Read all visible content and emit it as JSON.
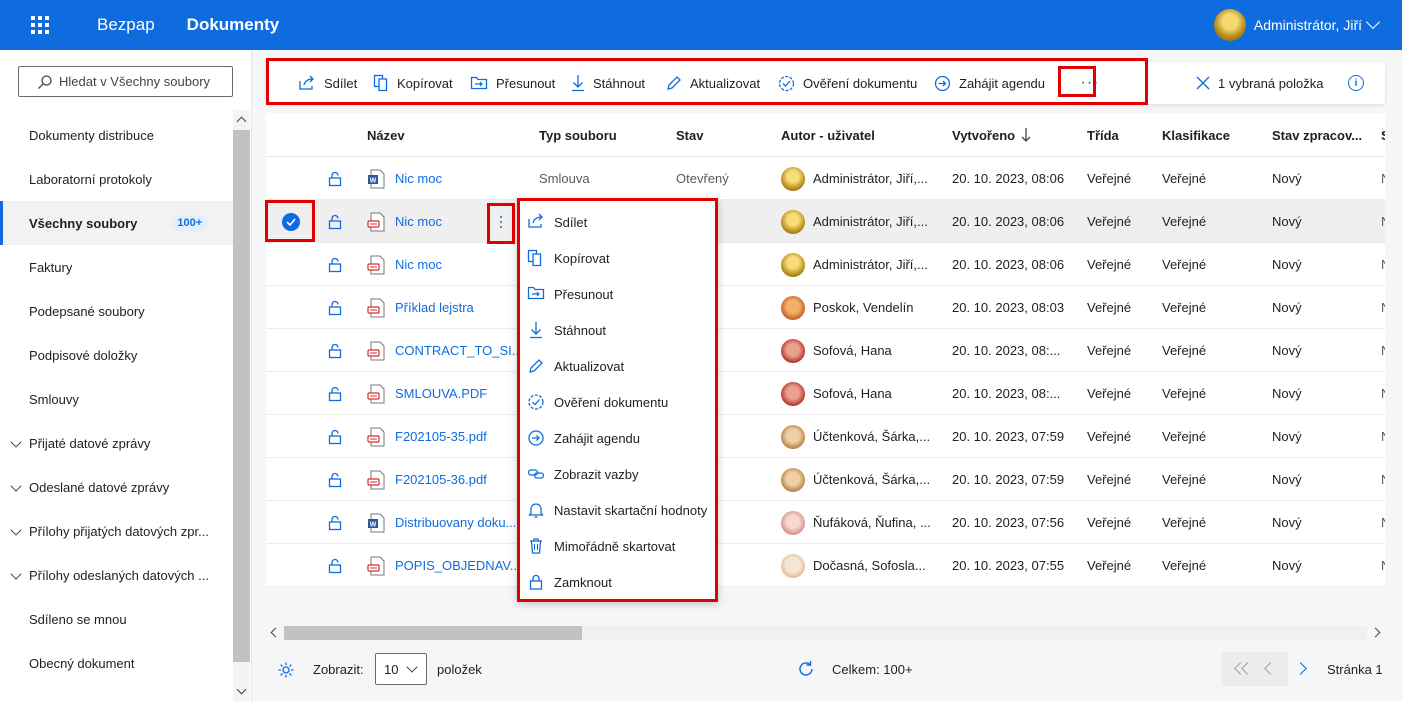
{
  "topbar": {
    "app_name": "Bezpap",
    "section": "Dokumenty",
    "user_name": "Administrátor, Jiří"
  },
  "sidebar": {
    "search_placeholder": "Hledat v Všechny soubory",
    "items": [
      {
        "label": "Dokumenty distribuce",
        "expandable": false
      },
      {
        "label": "Laboratorní protokoly",
        "expandable": false
      },
      {
        "label": "Všechny soubory",
        "expandable": false,
        "active": true,
        "badge": "100+"
      },
      {
        "label": "Faktury",
        "expandable": false
      },
      {
        "label": "Podepsané soubory",
        "expandable": false
      },
      {
        "label": "Podpisové doložky",
        "expandable": false
      },
      {
        "label": "Smlouvy",
        "expandable": false
      },
      {
        "label": "Přijaté datové zprávy",
        "expandable": true
      },
      {
        "label": "Odeslané datové zprávy",
        "expandable": true
      },
      {
        "label": "Přílohy přijatých datových zpr...",
        "expandable": true
      },
      {
        "label": "Přílohy odeslaných datových ...",
        "expandable": true
      },
      {
        "label": "Sdíleno se mnou",
        "expandable": false
      },
      {
        "label": "Obecný dokument",
        "expandable": false
      }
    ]
  },
  "commandbar": {
    "share": "Sdílet",
    "copy": "Kopírovat",
    "move": "Přesunout",
    "download": "Stáhnout",
    "update": "Aktualizovat",
    "verify": "Ověření dokumentu",
    "start_agenda": "Zahájit agendu",
    "more": "···",
    "selection": "1 vybraná položka",
    "info": "i"
  },
  "table": {
    "headers": {
      "name": "Název",
      "type": "Typ souboru",
      "state": "Stav",
      "author": "Autor - uživatel",
      "created": "Vytvořeno",
      "class": "Třída",
      "classification": "Klasifikace",
      "processing": "Stav zpracov...",
      "extra": "S"
    },
    "rows": [
      {
        "icon": "word",
        "name": "Nic moc",
        "type": "Smlouva",
        "state": "Otevřený",
        "author": "Administrátor, Jiří,...",
        "avatar": "gold",
        "created": "20. 10. 2023, 08:06",
        "class": "Veřejné",
        "classification": "Veřejné",
        "processing": "Nový",
        "extra": "N"
      },
      {
        "icon": "pdf",
        "name": "Nic moc",
        "type": "",
        "state": "vaný",
        "author": "Administrátor, Jiří,...",
        "avatar": "gold",
        "created": "20. 10. 2023, 08:06",
        "class": "Veřejné",
        "classification": "Veřejné",
        "processing": "Nový",
        "extra": "N",
        "selected": true
      },
      {
        "icon": "pdf",
        "name": "Nic moc",
        "type": "",
        "state": "ený",
        "author": "Administrátor, Jiří,...",
        "avatar": "gold",
        "created": "20. 10. 2023, 08:06",
        "class": "Veřejné",
        "classification": "Veřejné",
        "processing": "Nový",
        "extra": "N"
      },
      {
        "icon": "pdf",
        "name": "Příklad lejstra",
        "type": "",
        "state": "ený",
        "author": "Poskok, Vendelín",
        "avatar": "orange",
        "created": "20. 10. 2023, 08:03",
        "class": "Veřejné",
        "classification": "Veřejné",
        "processing": "Nový",
        "extra": "N"
      },
      {
        "icon": "pdf",
        "name": "CONTRACT_TO_SI...",
        "type": "",
        "state": "ený",
        "author": "Sofová, Hana",
        "avatar": "red",
        "created": "20. 10. 2023, 08:...",
        "class": "Veřejné",
        "classification": "Veřejné",
        "processing": "Nový",
        "extra": "N"
      },
      {
        "icon": "pdf",
        "name": "SMLOUVA.PDF",
        "type": "",
        "state": "ený",
        "author": "Sofová, Hana",
        "avatar": "red",
        "created": "20. 10. 2023, 08:...",
        "class": "Veřejné",
        "classification": "Veřejné",
        "processing": "Nový",
        "extra": "N"
      },
      {
        "icon": "pdf",
        "name": "F202105-35.pdf",
        "type": "",
        "state": "vaný",
        "author": "Účtenková, Šárka,...",
        "avatar": "tan",
        "created": "20. 10. 2023, 07:59",
        "class": "Veřejné",
        "classification": "Veřejné",
        "processing": "Nový",
        "extra": "N"
      },
      {
        "icon": "pdf",
        "name": "F202105-36.pdf",
        "type": "",
        "state": "vaný",
        "author": "Účtenková, Šárka,...",
        "avatar": "tan",
        "created": "20. 10. 2023, 07:59",
        "class": "Veřejné",
        "classification": "Veřejné",
        "processing": "Nový",
        "extra": "N"
      },
      {
        "icon": "word",
        "name": "Distribuovany doku...",
        "type": "",
        "state": "ený",
        "author": "Ňufáková, Ňufina, ...",
        "avatar": "pink",
        "created": "20. 10. 2023, 07:56",
        "class": "Veřejné",
        "classification": "Veřejné",
        "processing": "Nový",
        "extra": "N"
      },
      {
        "icon": "pdf",
        "name": "POPIS_OBJEDNAV...",
        "type": "",
        "state": "ený",
        "author": "Dočasná, Sofosla...",
        "avatar": "light",
        "created": "20. 10. 2023, 07:55",
        "class": "Veřejné",
        "classification": "Veřejné",
        "processing": "Nový",
        "extra": "N"
      }
    ]
  },
  "context_menu": [
    {
      "label": "Sdílet",
      "icon": "share-icon"
    },
    {
      "label": "Kopírovat",
      "icon": "copy-icon"
    },
    {
      "label": "Přesunout",
      "icon": "move-icon"
    },
    {
      "label": "Stáhnout",
      "icon": "download-icon"
    },
    {
      "label": "Aktualizovat",
      "icon": "edit-icon"
    },
    {
      "label": "Ověření dokumentu",
      "icon": "verify-icon"
    },
    {
      "label": "Zahájit agendu",
      "icon": "start-agenda-icon"
    },
    {
      "label": "Zobrazit vazby",
      "icon": "link-icon"
    },
    {
      "label": "Nastavit skartační hodnoty",
      "icon": "bell-icon"
    },
    {
      "label": "Mimořádně skartovat",
      "icon": "trash-icon"
    },
    {
      "label": "Zamknout",
      "icon": "lock-icon"
    }
  ],
  "footer": {
    "show_label": "Zobrazit:",
    "page_size": "10",
    "items_label": "položek",
    "total": "Celkem: 100+",
    "page_label": "Stránka 1"
  },
  "colors": {
    "brand": "#0f6cde",
    "highlight": "#e00000"
  }
}
